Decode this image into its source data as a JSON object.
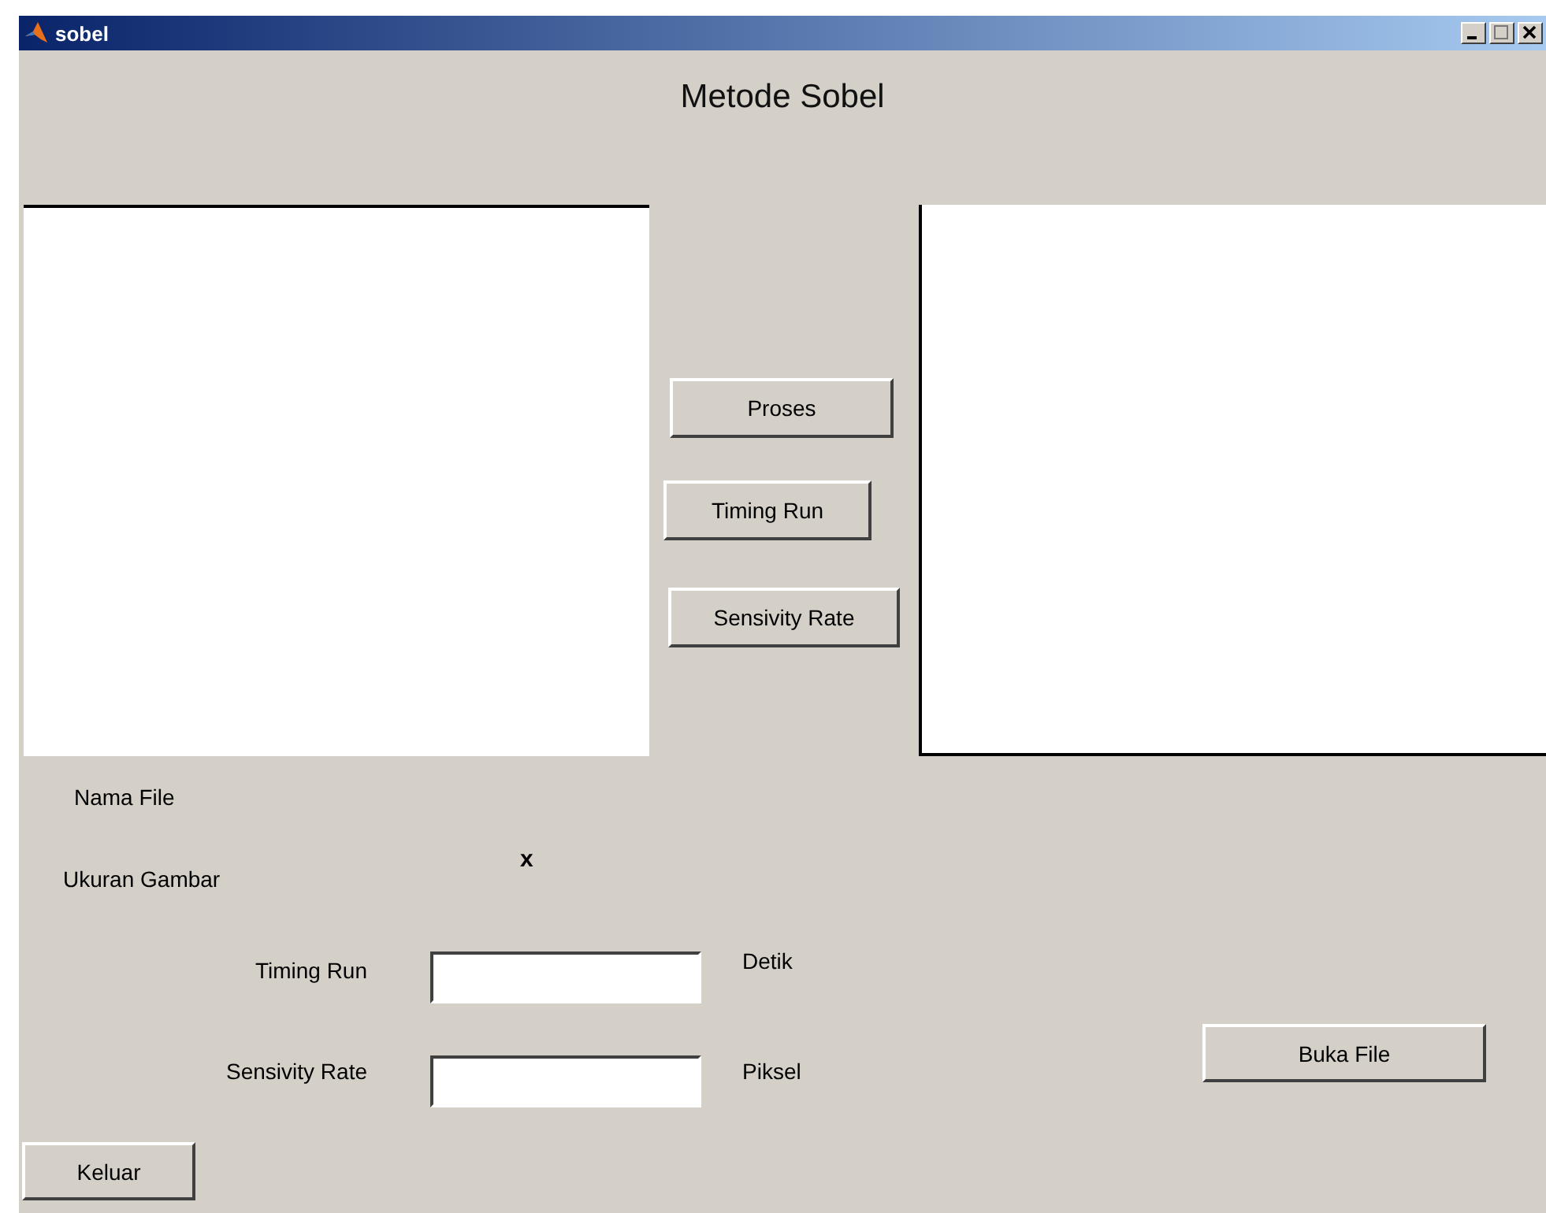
{
  "window": {
    "title": "sobel"
  },
  "heading": "Metode Sobel",
  "center_buttons": [
    {
      "label": "Proses"
    },
    {
      "label": "Timing Run"
    },
    {
      "label": "Sensivity Rate"
    }
  ],
  "info": {
    "file_name_label": "Nama File",
    "image_size_label": "Ukuran Gambar",
    "image_size_separator": "x"
  },
  "fields": [
    {
      "label": "Timing Run",
      "unit": "Detik"
    },
    {
      "label": "Sensivity Rate",
      "unit": "Piksel"
    }
  ],
  "open_button": "Buka File",
  "exit_button": "Keluar"
}
